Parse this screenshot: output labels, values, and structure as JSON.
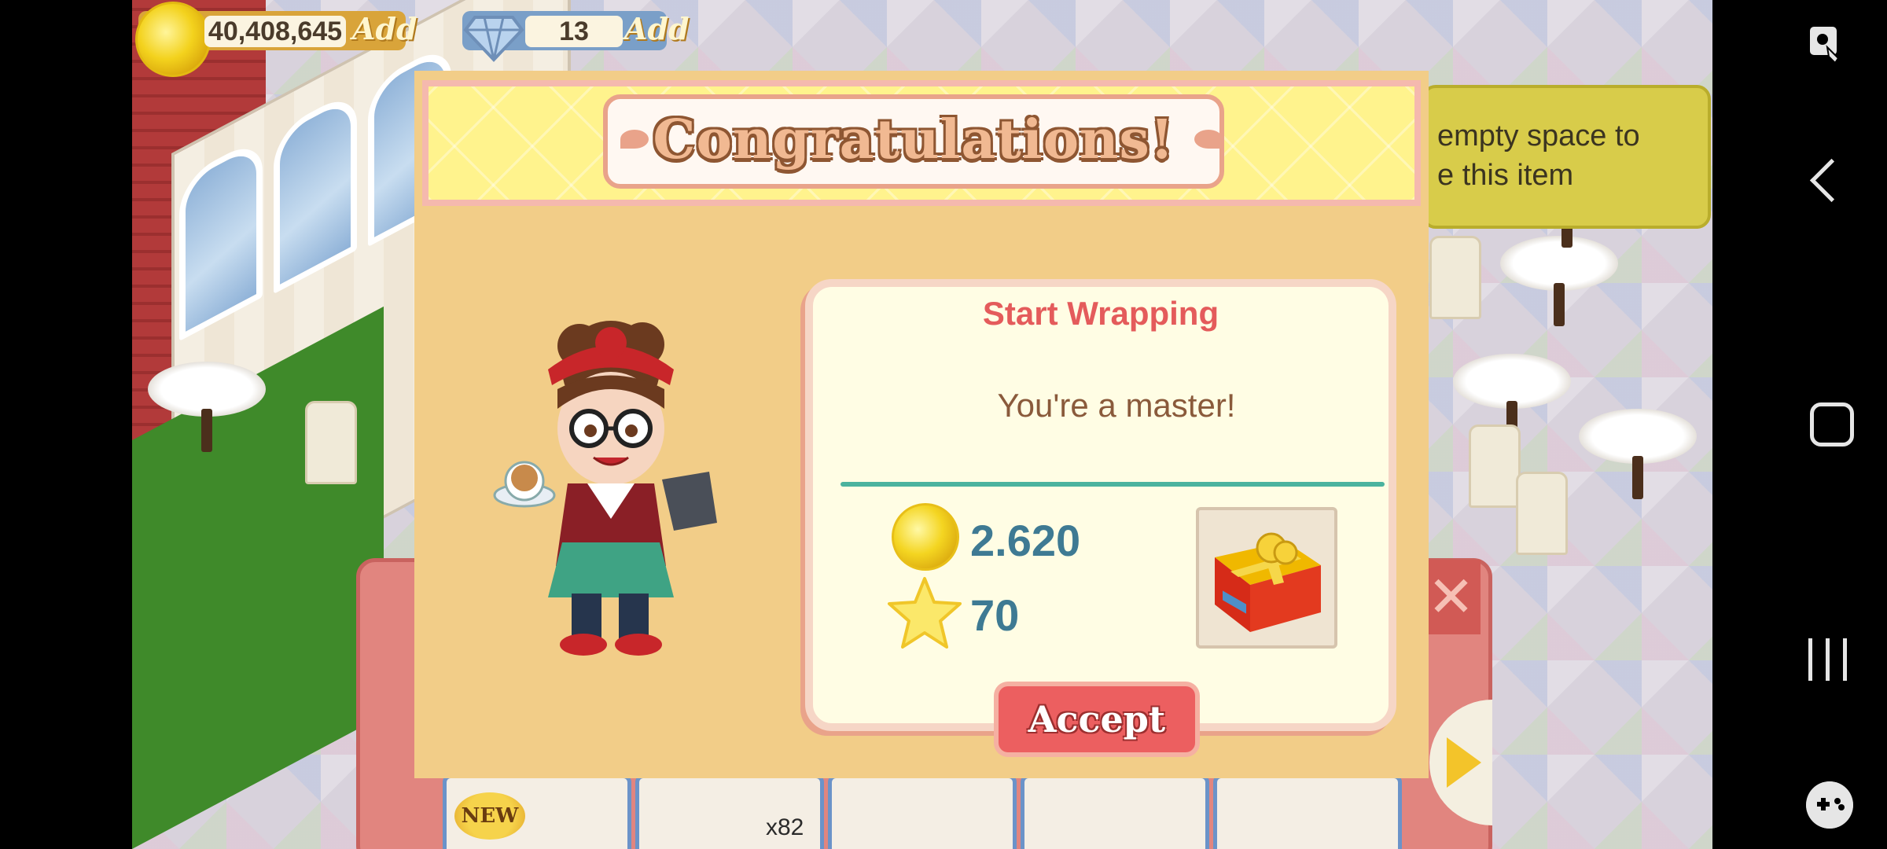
{
  "hud": {
    "coins": "40,408,645",
    "coins_add_label": "Add",
    "gems": "13",
    "gems_add_label": "Add"
  },
  "hint": {
    "text": "empty space to\ne this item"
  },
  "tray": {
    "new_badge": "NEW",
    "slot_count": "x82"
  },
  "dialog": {
    "banner_title": "Congratulations!",
    "card_title": "Start Wrapping",
    "message": "You're a master!",
    "reward_coins": "2.620",
    "reward_stars": "70",
    "reward_item_icon": "gift-box-icon",
    "accept_label": "Accept"
  },
  "colors": {
    "dialog_bg": "#f2cd88",
    "card_title": "#e45b5b",
    "reward_value": "#3e7a93",
    "accept_button": "#ec5f60",
    "divider": "#4bb39e"
  },
  "navbar": {
    "icons": [
      "screen-lock-icon",
      "back-icon",
      "home-icon",
      "recents-icon",
      "game-tools-icon"
    ]
  }
}
